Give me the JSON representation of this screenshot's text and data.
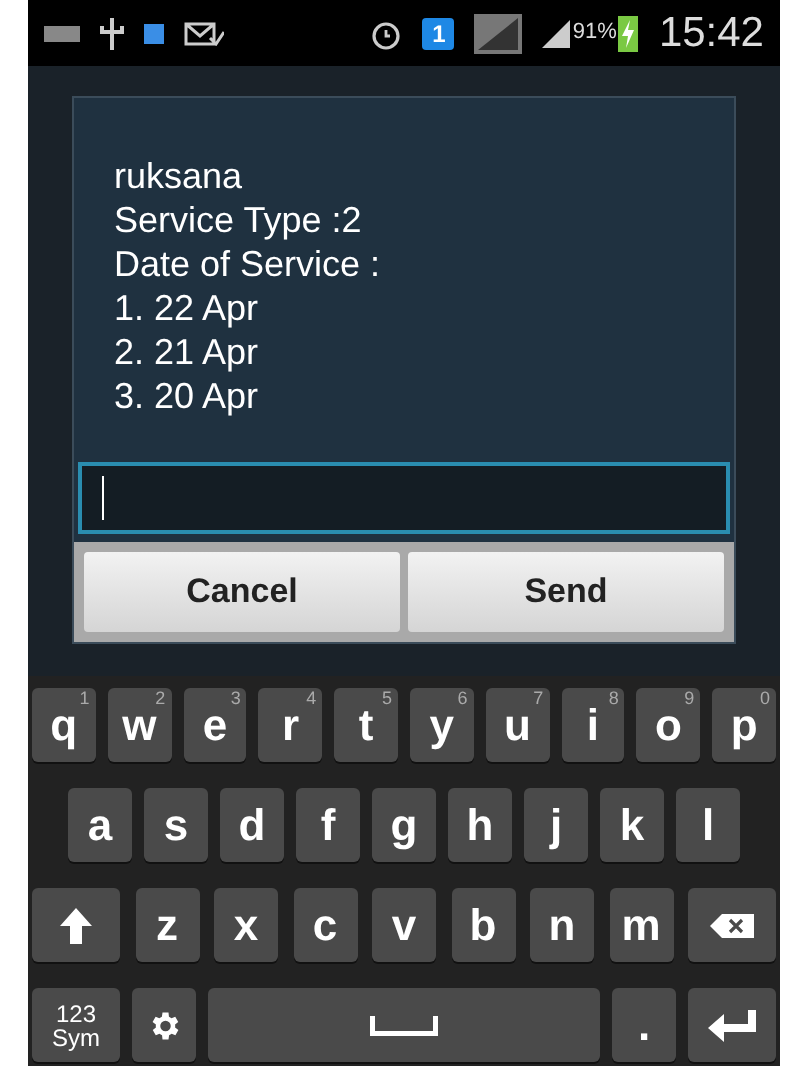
{
  "status_bar": {
    "sim_badge": "1",
    "battery": "91%",
    "time": "15:42"
  },
  "dialog": {
    "lines": [
      "ruksana",
      "Service Type :2",
      "Date of Service  :",
      "1. 22 Apr",
      "2. 21 Apr",
      "3. 20 Apr"
    ],
    "buttons": [
      "Cancel",
      "Send"
    ]
  },
  "keyboard": {
    "rows": [
      [
        {
          "kind": "letter",
          "label": "q",
          "hint": "1"
        },
        {
          "kind": "letter",
          "label": "w",
          "hint": "2"
        },
        {
          "kind": "letter",
          "label": "e",
          "hint": "3"
        },
        {
          "kind": "letter",
          "label": "r",
          "hint": "4"
        },
        {
          "kind": "letter",
          "label": "t",
          "hint": "5"
        },
        {
          "kind": "letter",
          "label": "y",
          "hint": "6"
        },
        {
          "kind": "letter",
          "label": "u",
          "hint": "7"
        },
        {
          "kind": "letter",
          "label": "i",
          "hint": "8"
        },
        {
          "kind": "letter",
          "label": "o",
          "hint": "9"
        },
        {
          "kind": "letter",
          "label": "p",
          "hint": "0"
        }
      ],
      [
        {
          "kind": "letter",
          "label": "a"
        },
        {
          "kind": "letter",
          "label": "s"
        },
        {
          "kind": "letter",
          "label": "d"
        },
        {
          "kind": "letter",
          "label": "f"
        },
        {
          "kind": "letter",
          "label": "g"
        },
        {
          "kind": "letter",
          "label": "h"
        },
        {
          "kind": "letter",
          "label": "j"
        },
        {
          "kind": "letter",
          "label": "k"
        },
        {
          "kind": "letter",
          "label": "l"
        }
      ],
      [
        {
          "kind": "shift"
        },
        {
          "kind": "letter",
          "label": "z"
        },
        {
          "kind": "letter",
          "label": "x"
        },
        {
          "kind": "letter",
          "label": "c"
        },
        {
          "kind": "letter",
          "label": "v"
        },
        {
          "kind": "letter",
          "label": "b"
        },
        {
          "kind": "letter",
          "label": "n"
        },
        {
          "kind": "letter",
          "label": "m"
        },
        {
          "kind": "backspace"
        }
      ],
      [
        {
          "kind": "sym",
          "lines": [
            "123",
            "Sym"
          ]
        },
        {
          "kind": "settings"
        },
        {
          "kind": "space"
        },
        {
          "kind": "letter",
          "label": "."
        },
        {
          "kind": "enter"
        }
      ]
    ]
  }
}
